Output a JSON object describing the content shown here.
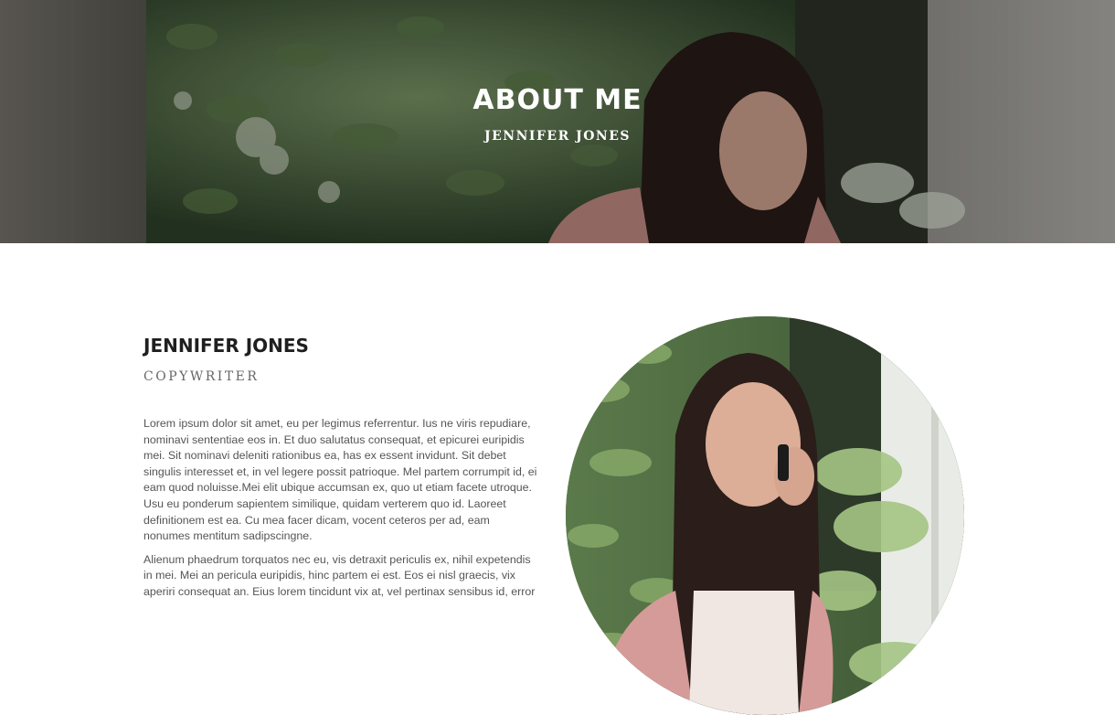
{
  "hero": {
    "title": "ABOUT ME",
    "subtitle": "JENNIFER JONES",
    "image": "woman-on-phone-with-plants-photo"
  },
  "bio": {
    "name": "JENNIFER JONES",
    "role": "COPYWRITER",
    "paragraphs": [
      "Lorem ipsum dolor sit amet, eu per legimus referrentur. Ius ne viris repudiare, nominavi sententiae eos in. Et duo salutatus consequat, et epicurei euripidis mei. Sit nominavi deleniti rationibus ea, has ex essent invidunt. Sit debet singulis interesset et, in vel legere possit patrioque. Mel partem corrumpit id, ei eam quod noluisse.Mei elit ubique accumsan ex, quo ut etiam facete utroque. Usu eu ponderum sapientem similique, quidam verterem quo id. Laoreet definitionem est ea. Cu mea facer dicam, vocent ceteros per ad, eam nonumes mentitum sadipscingne.",
      "Alienum phaedrum torquatos nec eu, vis detraxit periculis ex, nihil expetendis in mei. Mei an pericula euripidis, hinc partem ei est. Eos ei nisl graecis, vix aperiri consequat an. Eius lorem tincidunt vix at, vel pertinax sensibus id, error"
    ],
    "portrait": "portrait-photo"
  },
  "colors": {
    "heading": "#1f1f1f",
    "subheading": "#666666",
    "body_text": "#555555",
    "hero_text": "#ffffff"
  }
}
